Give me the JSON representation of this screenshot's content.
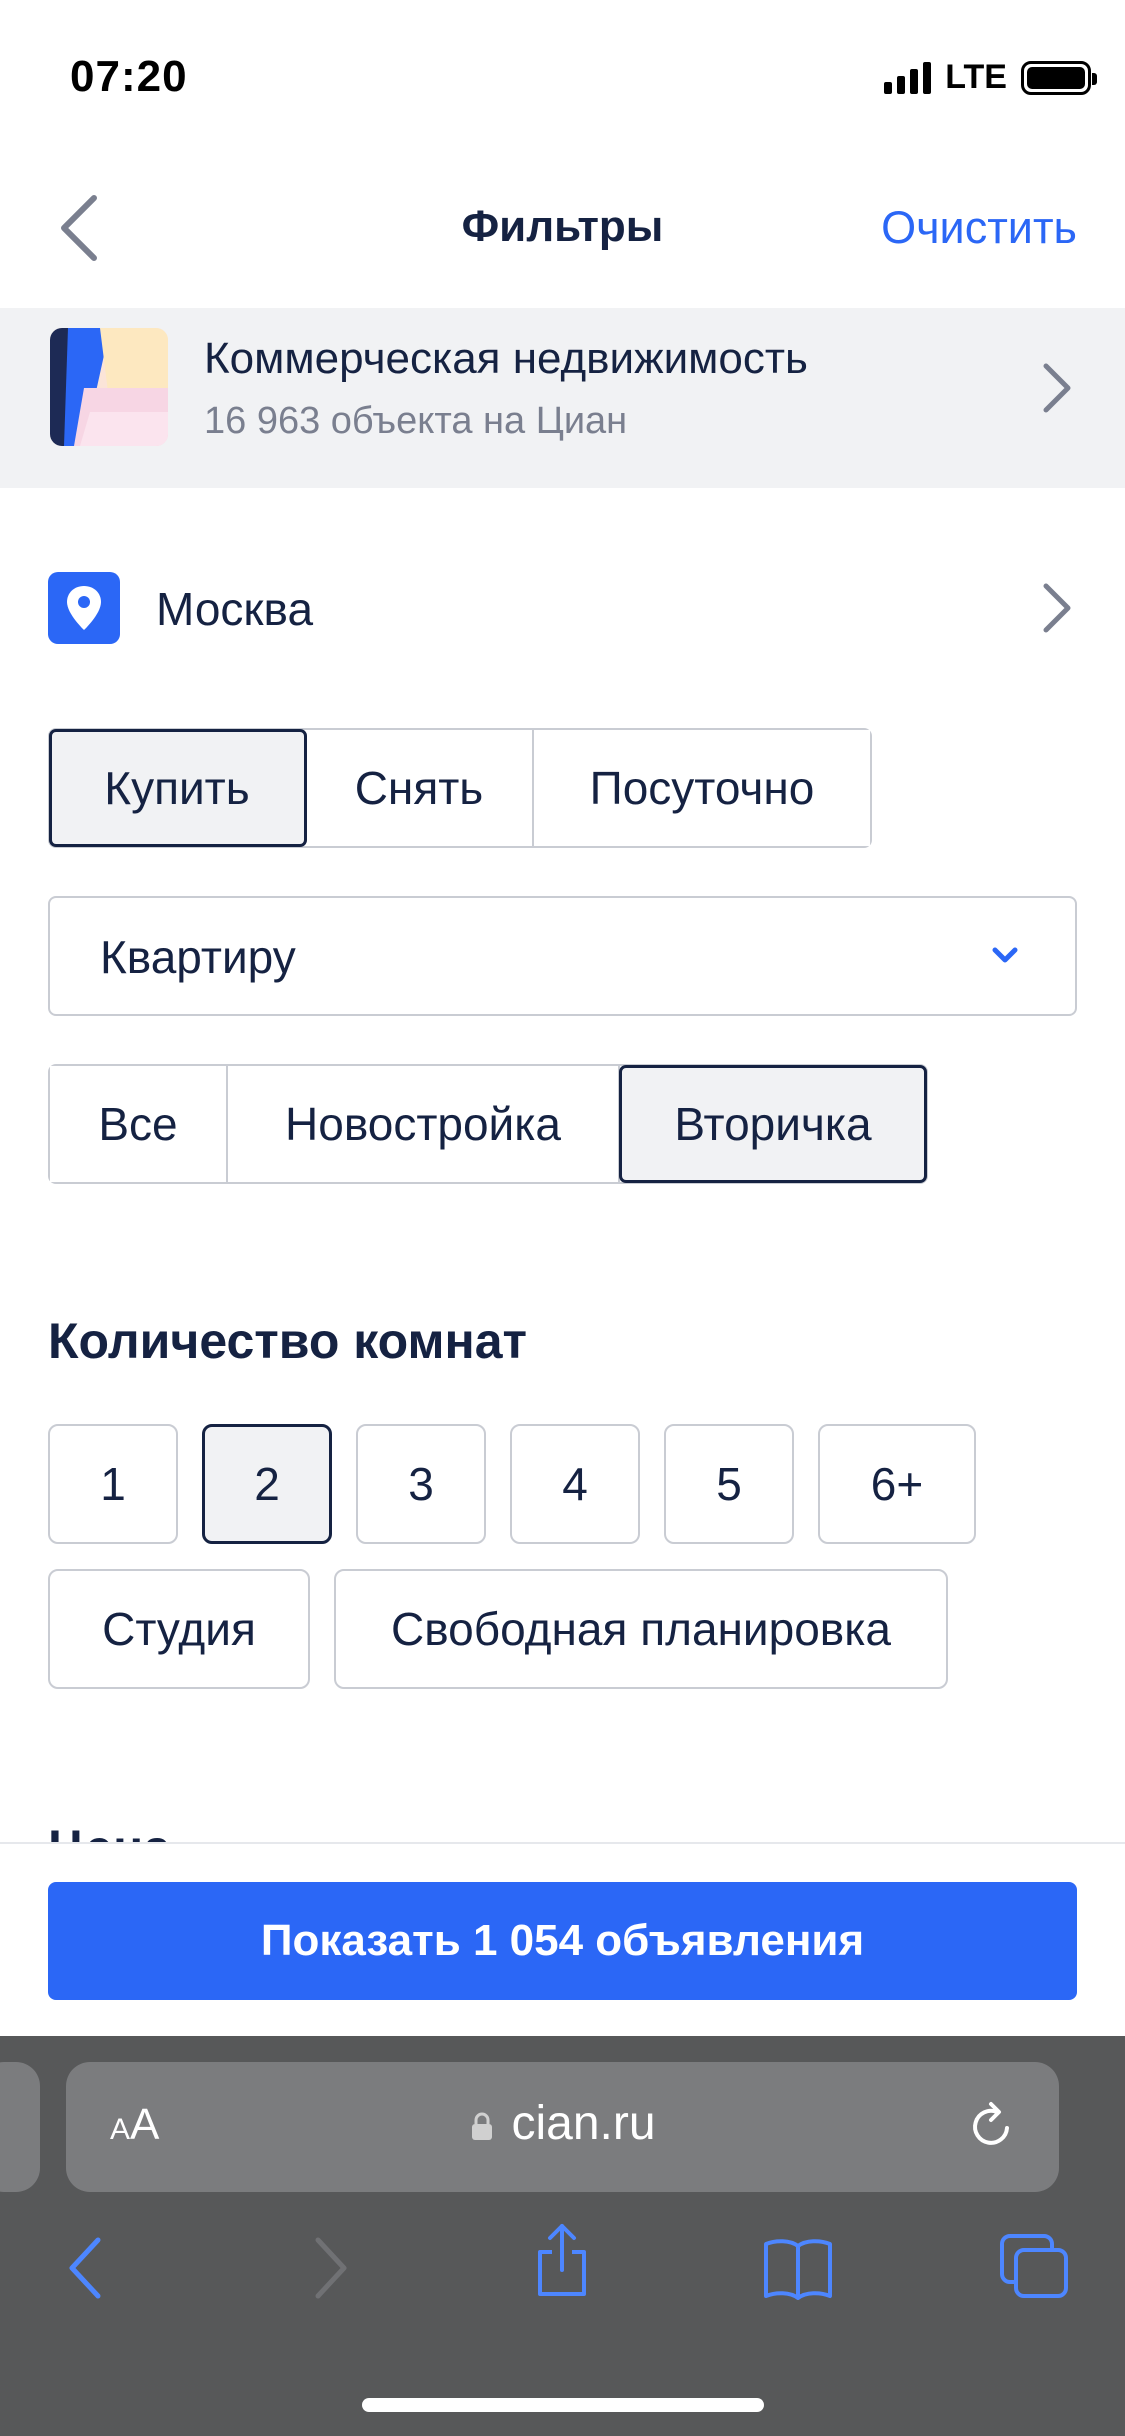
{
  "status_bar": {
    "time": "07:20",
    "network": "LTE"
  },
  "header": {
    "title": "Фильтры",
    "clear_label": "Очистить"
  },
  "banner": {
    "title": "Коммерческая недвижимость",
    "subtitle": "16 963 объекта на Циан"
  },
  "location": {
    "city": "Москва"
  },
  "deal_type": {
    "options": [
      "Купить",
      "Снять",
      "Посуточно"
    ],
    "selected": "Купить"
  },
  "property_type": {
    "selected": "Квартиру"
  },
  "market": {
    "options": [
      "Все",
      "Новостройка",
      "Вторичка"
    ],
    "selected": "Вторичка"
  },
  "rooms": {
    "title": "Количество комнат",
    "options": [
      "1",
      "2",
      "3",
      "4",
      "5",
      "6+",
      "Студия",
      "Свободная планировка"
    ],
    "selected": "2"
  },
  "price_section": {
    "title": "Цена"
  },
  "show_button": {
    "label": "Показать 1 054 объявления"
  },
  "browser": {
    "aa_small": "A",
    "aa_large": "A",
    "url": "cian.ru"
  },
  "colors": {
    "accent": "#2b67f6",
    "text": "#152242",
    "muted": "#7a7f8f",
    "border": "#c9ccd3"
  }
}
